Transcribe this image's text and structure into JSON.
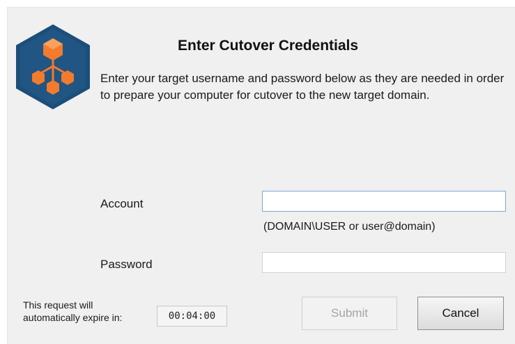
{
  "dialog": {
    "title": "Enter Cutover Credentials",
    "description": "Enter your target username and password below as they are needed in order to prepare your computer for cutover to the new target domain.",
    "logo_icon": "network-hub-icon",
    "colors": {
      "logo_hexagon": "#1d4e7a",
      "logo_nodes": "#f27b2d",
      "background": "#f0f0f0"
    }
  },
  "form": {
    "account_label": "Account",
    "account_value": "",
    "account_hint": "(DOMAIN\\USER or user@domain)",
    "password_label": "Password",
    "password_value": ""
  },
  "footer": {
    "expire_line1": "This request will",
    "expire_line2": "automatically expire in:",
    "timer": "00:04:00",
    "submit_label": "Submit",
    "cancel_label": "Cancel"
  }
}
